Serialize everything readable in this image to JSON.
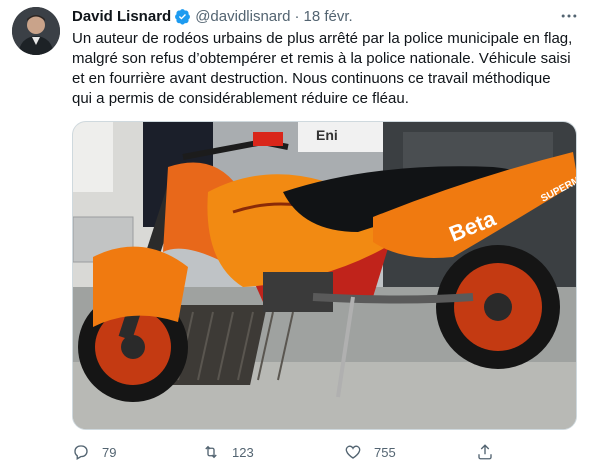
{
  "author": {
    "name": "David Lisnard",
    "handle": "@davidlisnard",
    "separator": "·",
    "date": "18 févr."
  },
  "tweet_text_lines": [
    "Un auteur de rodéos urbains de plus arrêté par la police municipale en flag,",
    "malgré son refus d’obtempérer et remis à la police nationale. Véhicule saisi",
    "et en fourrière avant destruction. Nous continuons ce travail méthodique",
    "qui a permis de considérablement réduire ce fléau."
  ],
  "media": {
    "bike_labels": {
      "brand": "Beta",
      "model": "SUPERMOT",
      "station_sign": "Eni"
    }
  },
  "actions": {
    "replies": "79",
    "retweets": "123",
    "likes": "755"
  },
  "colors": {
    "text_primary": "#0f1419",
    "text_secondary": "#536471",
    "verified_blue": "#1d9bf0",
    "border": "#cfd9de"
  },
  "icons": [
    "verified-badge-icon",
    "more-options-icon",
    "reply-icon",
    "retweet-icon",
    "like-icon",
    "share-icon"
  ]
}
